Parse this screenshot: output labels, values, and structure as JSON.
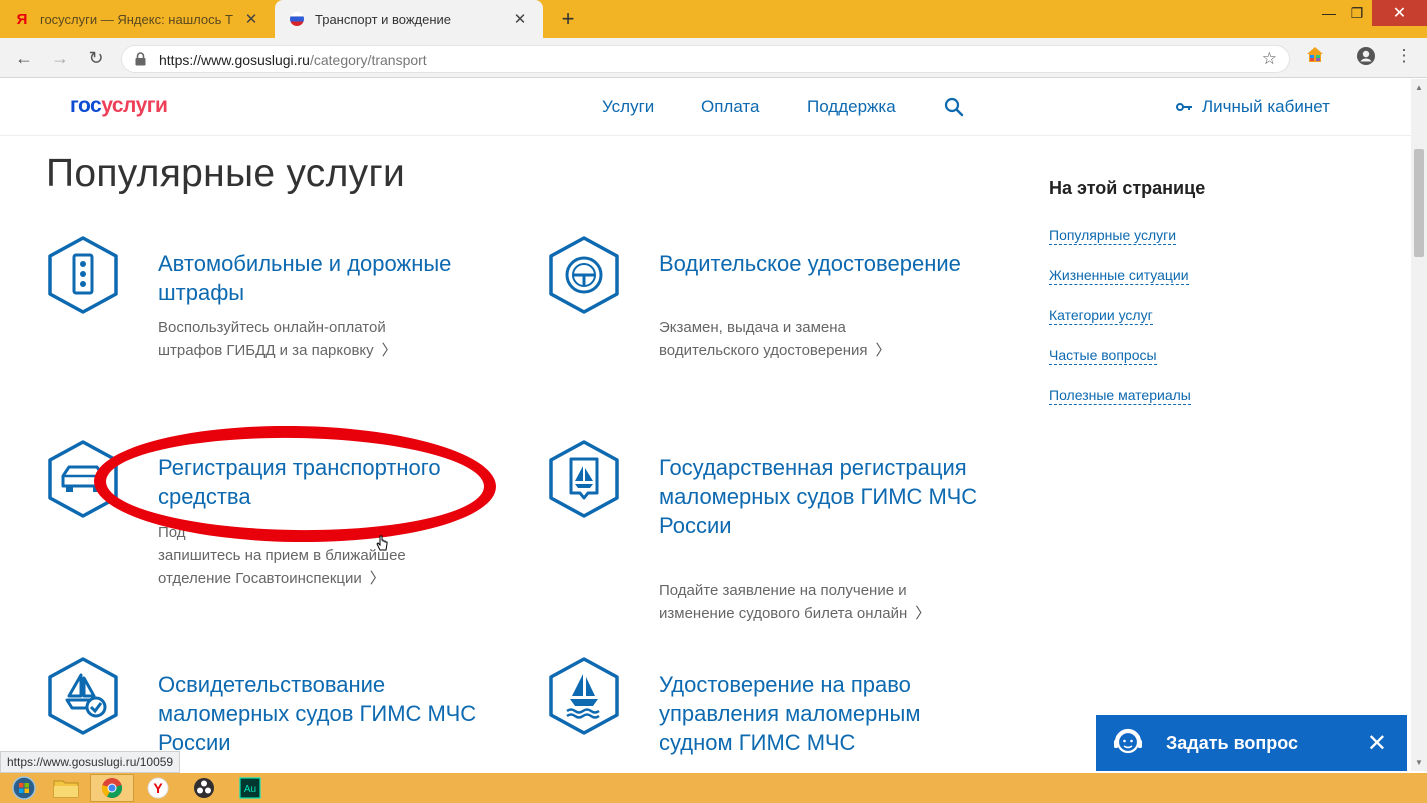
{
  "browser": {
    "tabs": [
      {
        "title": "госуслуги — Яндекс: нашлось Т",
        "favicon": "yandex-favicon",
        "active": false
      },
      {
        "title": "Транспорт и вождение",
        "favicon": "russia-flag-favicon",
        "active": true
      }
    ],
    "url_host": "https://www.gosuslugi.ru",
    "url_path": "/category/transport"
  },
  "header": {
    "logo_part1": "гос",
    "logo_part2": "услуги",
    "nav": [
      "Услуги",
      "Оплата",
      "Поддержка"
    ],
    "cabinet_label": "Личный кабинет"
  },
  "main": {
    "title": "Популярные услуги",
    "cards": [
      {
        "title": "Автомобильные и дорожные штрафы",
        "desc_line1": "Воспользуйтесь онлайн-оплатой",
        "desc_line2": "штрафов ГИБДД и за парковку",
        "icon": "traffic-light-icon"
      },
      {
        "title": "Водительское удостоверение",
        "desc_line1": "Экзамен, выдача и замена",
        "desc_line2": "водительского удостоверения",
        "icon": "steering-wheel-icon"
      },
      {
        "title": "Регистрация транспортного средства",
        "desc_line1": "Под",
        "desc_line2": "запишитесь на прием в ближайшее",
        "desc_line3": "отделение Госавтоинспекции",
        "icon": "car-icon"
      },
      {
        "title": "Государственная регистрация маломерных судов ГИМС МЧС России",
        "desc_line1": "Подайте заявление на получение и",
        "desc_line2": "изменение судового билета онлайн",
        "icon": "boat-document-icon"
      },
      {
        "title": "Освидетельствование маломерных судов ГИМС МЧС России",
        "icon": "boat-check-icon"
      },
      {
        "title": "Удостоверение на право управления маломерным судном ГИМС МЧС",
        "icon": "boat-waves-icon"
      }
    ]
  },
  "toc": {
    "heading": "На этой странице",
    "links": [
      "Популярные услуги",
      "Жизненные ситуации",
      "Категории услуг",
      "Частые вопросы",
      "Полезные материалы"
    ]
  },
  "ask_widget": {
    "label": "Задать вопрос"
  },
  "status_url": "https://www.gosuslugi.ru/10059",
  "colors": {
    "brand_blue": "#0d69b0",
    "logo_blue": "#0d4cd3",
    "logo_red": "#ee3f58",
    "annotation_red": "#e8000b",
    "widget_blue": "#0f68c3"
  }
}
